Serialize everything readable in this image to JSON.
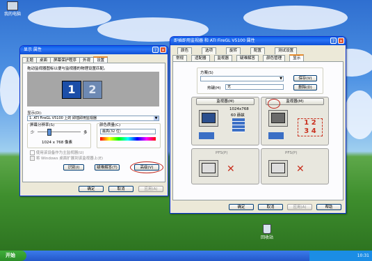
{
  "desktop": {
    "icon_top_label": "我的电脑",
    "icon_bottom_label": "回收站"
  },
  "taskbar": {
    "start_label": "开始",
    "tray_text": "10:31"
  },
  "display_props": {
    "title": "显示 属性",
    "tabs": [
      "主题",
      "桌面",
      "屏幕保护程序",
      "外观",
      "设置"
    ],
    "instruction": "拖动监视器图标以便与监视器的物理设置匹配。",
    "monitor1": "1",
    "monitor2": "2",
    "display_label": "显示(D):",
    "display_value": "1. ATI FireGL V5100 上的 即插即用监视器",
    "resolution_label": "屏幕分辨率(S)",
    "res_less": "少",
    "res_more": "多",
    "res_value": "1024 x 768 像素",
    "color_label": "颜色质量(C)",
    "color_value": "最高(32 位)",
    "checkbox1": "使用该设备作为主监视器(U)",
    "checkbox2": "将 Windows 桌面扩展到该监视器上(E)",
    "identify_btn": "识别(I)",
    "troubleshoot_btn": "疑难解答(T)",
    "advanced_btn": "高级(V)",
    "ok_btn": "确定",
    "cancel_btn": "取消",
    "apply_btn": "应用(A)"
  },
  "ati_props": {
    "title": "即插即用监视器 和 ATI FireGL V5100 属性",
    "tabs_row1": [
      "颜色",
      "选项",
      "旋转",
      "配置",
      "测试设置"
    ],
    "tabs_row2": [
      "常规",
      "适配器",
      "监视器",
      "疑难解答",
      "颜色管理",
      "显示"
    ],
    "scheme_label": "方案(S)",
    "save_btn": "保存(V)",
    "hotkey_label": "热键(H)",
    "hotkey_value": "无",
    "delete_btn": "删除(D)",
    "slot1_head": "监视器(M)",
    "slot1_info": [
      "1024x768",
      "60 赫兹"
    ],
    "slot2_head": "监视器(M)",
    "slot3_label": "PFS(P)",
    "slot4_label": "PFS(P)",
    "ok_btn": "确定",
    "cancel_btn": "取消",
    "apply_btn": "应用(A)",
    "help_btn": "帮助"
  }
}
